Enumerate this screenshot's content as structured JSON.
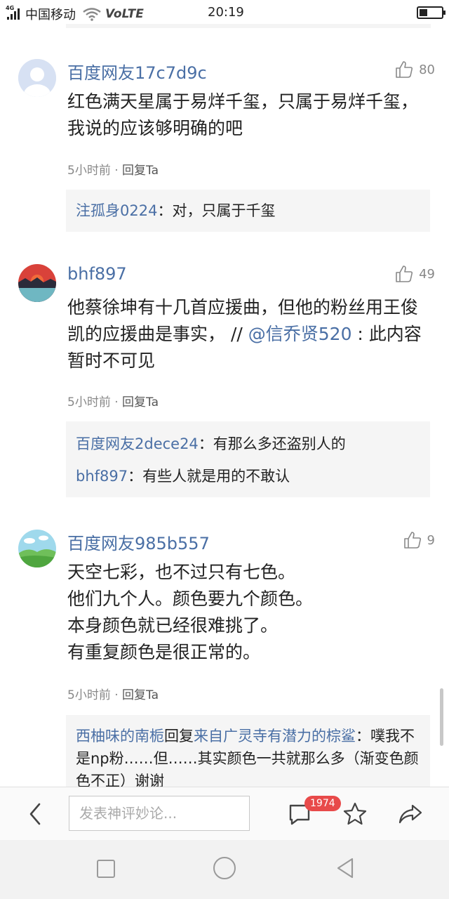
{
  "status_bar": {
    "network_type": "4G",
    "carrier": "中国移动",
    "volte": "VoLTE",
    "time": "20:19",
    "battery_level": 0.35
  },
  "comments": [
    {
      "username": "百度网友17c7d9c",
      "likes": "80",
      "text": "红色满天星属于易烊千玺，只属于易烊千玺，我说的应该够明确的吧",
      "time": "5小时前",
      "reply_label": "回复Ta",
      "replies": [
        {
          "name": "注孤身0224",
          "text": "：对，只属于千玺"
        }
      ]
    },
    {
      "username": "bhf897",
      "likes": "49",
      "text_before": "他蔡徐坤有十几首应援曲，但他的粉丝用王俊凯的应援曲是事实，",
      "separator": " // ",
      "mention": "@信乔贤520",
      "text_after": " : 此内容暂时不可见",
      "time": "5小时前",
      "reply_label": "回复Ta",
      "replies": [
        {
          "name": "百度网友2dece24",
          "text": "：有那么多还盗别人的"
        },
        {
          "name": "bhf897",
          "text": "：有些人就是用的不敢认"
        }
      ]
    },
    {
      "username": "百度网友985b557",
      "likes": "9",
      "lines": [
        "天空七彩，也不过只有七色。",
        "他们九个人。颜色要九个颜色。",
        "本身颜色就已经很难挑了。",
        "有重复颜色是很正常的。"
      ],
      "time": "5小时前",
      "reply_label": "回复Ta",
      "replies": [
        {
          "name": "西柚味的南栀",
          "middle": "回复",
          "target": "来自广灵寺有潜力的棕鲨",
          "text": "：噗我不是np粉……但……其实颜色一共就那么多（渐变色颜色不正）谢谢"
        }
      ]
    }
  ],
  "bottom_bar": {
    "input_placeholder": "发表神评妙论...",
    "comment_count": "1974"
  },
  "colors": {
    "link_blue": "#4a6fa5",
    "badge_red": "#e84a4a",
    "reply_bg": "#f5f5f5"
  },
  "icons": [
    "back-arrow-icon",
    "comment-bubble-icon",
    "star-icon",
    "share-icon",
    "thumbs-up-icon"
  ]
}
